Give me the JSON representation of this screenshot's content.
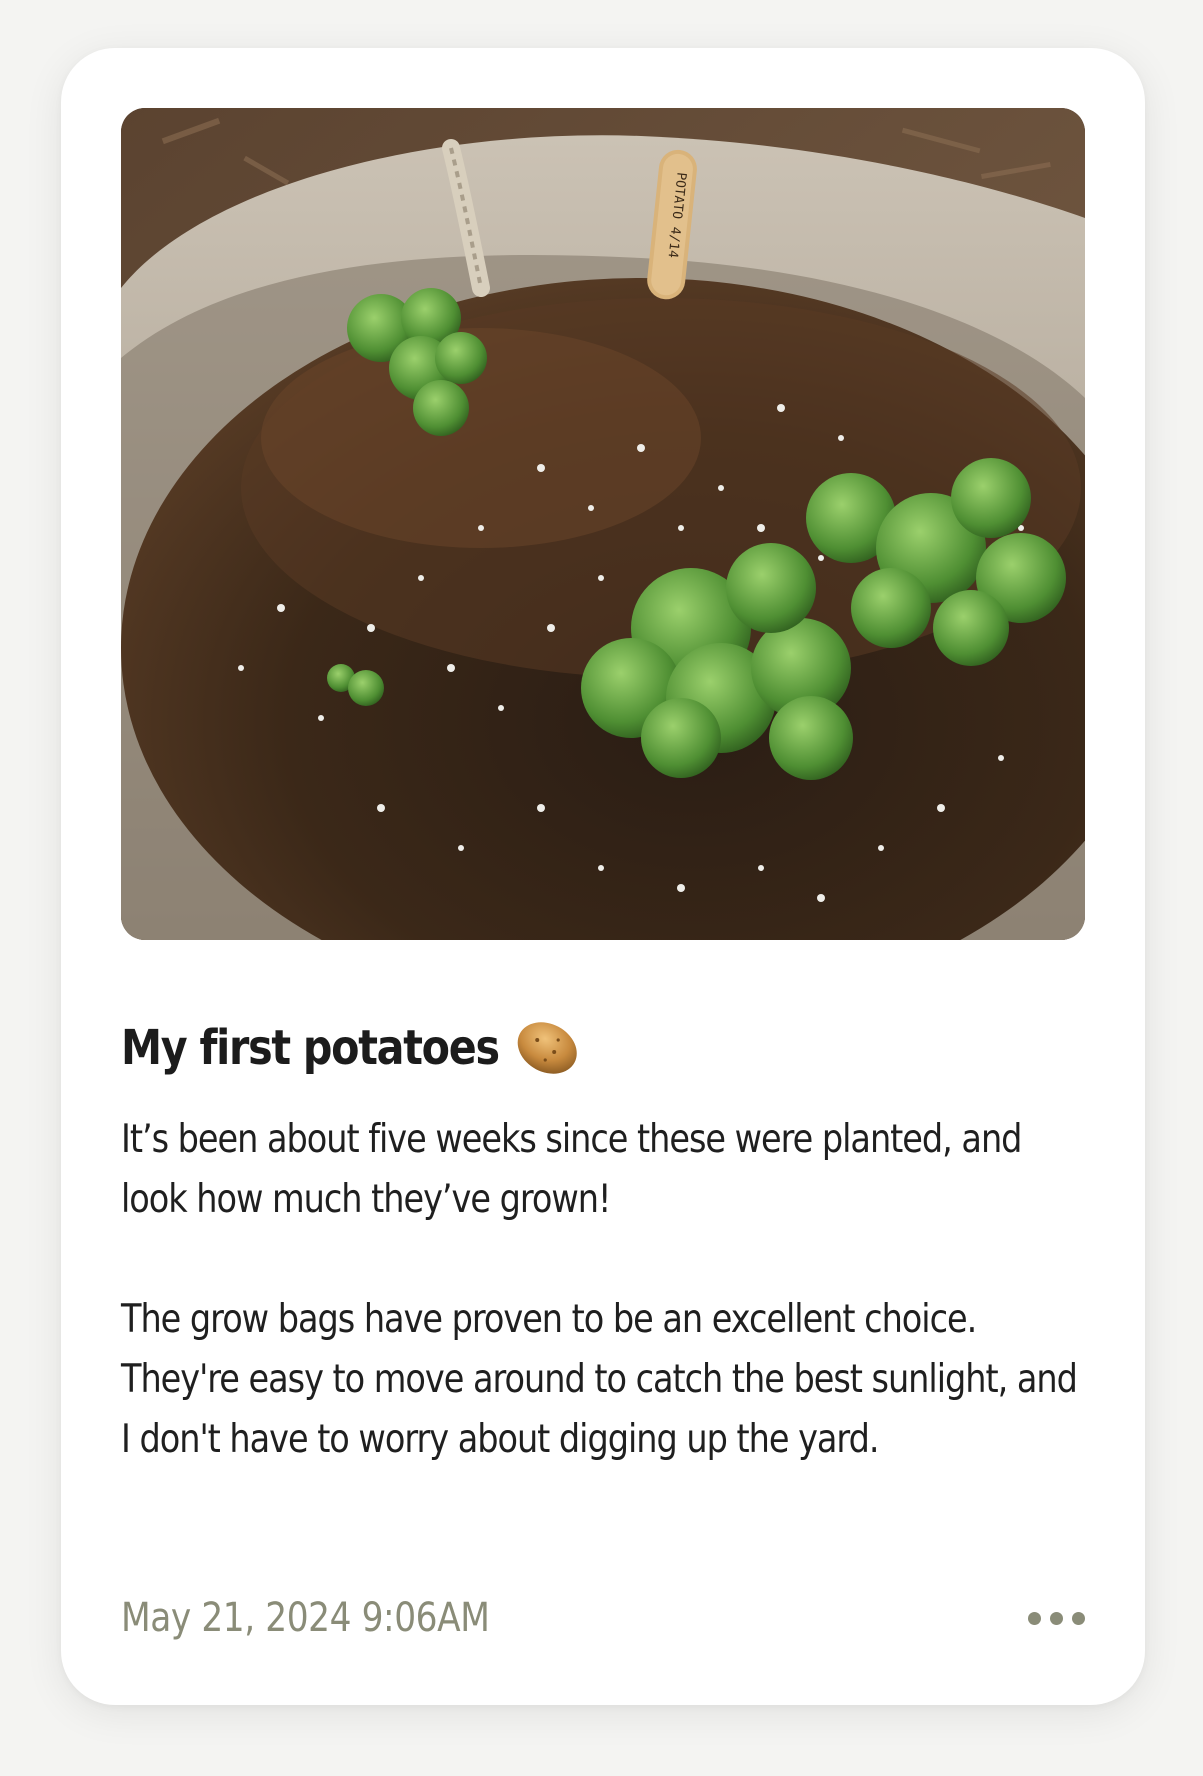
{
  "post": {
    "photo_alt": "Potato plants growing in a fabric grow bag",
    "plant_tag": "POTATO  4/14",
    "title": "My first potatoes",
    "title_emoji": "potato-icon",
    "body_paragraphs": [
      "It’s been about five weeks since these were planted, and look how much they’ve grown!",
      "The grow bags have proven to be an excellent choice. They're easy to move around to catch the best sunlight, and I don't have to worry about digging up the yard."
    ],
    "timestamp": "May 21, 2024 9:06AM",
    "more_icon": "more-horizontal-icon"
  },
  "colors": {
    "card_bg": "#ffffff",
    "page_bg": "#f4f4f2",
    "title_text": "#1c1c1c",
    "muted_text": "#8a8c78"
  }
}
